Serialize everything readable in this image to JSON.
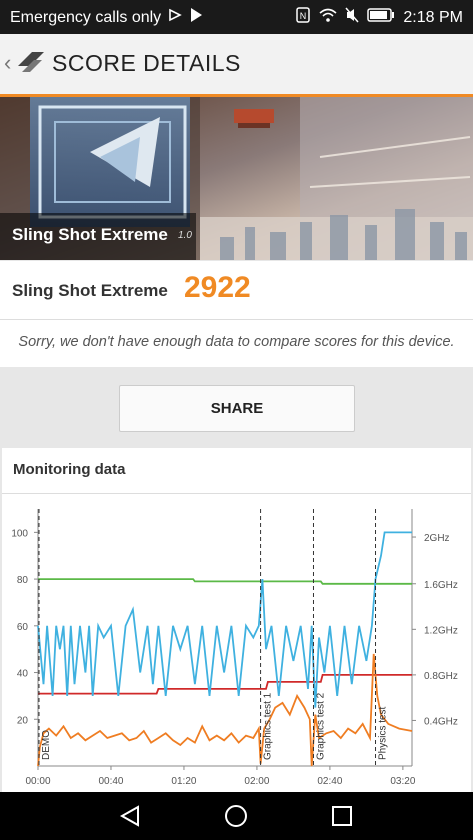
{
  "status": {
    "left_text": "Emergency calls only",
    "time": "2:18 PM"
  },
  "appbar": {
    "title": "SCORE DETAILS"
  },
  "banner": {
    "test_name": "Sling Shot Extreme",
    "version": "1.0"
  },
  "score": {
    "label": "Sling Shot Extreme",
    "value": "2922"
  },
  "note": "Sorry, we don't have enough data to compare scores for this device.",
  "share_label": "SHARE",
  "monitoring": {
    "title": "Monitoring data"
  },
  "chart_data": {
    "type": "line",
    "y_left_ticks": [
      "100",
      "80",
      "60",
      "40",
      "20"
    ],
    "y_right_ticks": [
      "2GHz",
      "1.6GHz",
      "1.2GHz",
      "0.8GHz",
      "0.4GHz"
    ],
    "x_ticks": [
      "00:00",
      "00:40",
      "01:20",
      "02:00",
      "02:40",
      "03:20"
    ],
    "ylim": [
      0,
      110
    ],
    "xlim_seconds": [
      0,
      205
    ],
    "markers": [
      {
        "label": "DEMO",
        "t": 0
      },
      {
        "label": "Graphics test 1",
        "t": 122
      },
      {
        "label": "Graphics test 2",
        "t": 151
      },
      {
        "label": "Physics test",
        "t": 185
      }
    ],
    "series": [
      {
        "color": "#5bb947",
        "t": [
          0,
          85,
          86,
          155,
          156,
          205
        ],
        "values": [
          80,
          80,
          79,
          79,
          78,
          78
        ]
      },
      {
        "color": "#d02a2a",
        "t": [
          0,
          65,
          66,
          125,
          126,
          155,
          156,
          205
        ],
        "values": [
          31,
          31,
          33,
          33,
          36,
          36,
          39,
          39
        ]
      },
      {
        "color": "#3fb1e0",
        "t": [
          0,
          3,
          5,
          8,
          10,
          12,
          14,
          16,
          18,
          20,
          23,
          26,
          28,
          30,
          33,
          36,
          40,
          44,
          48,
          52,
          56,
          60,
          63,
          66,
          70,
          74,
          78,
          82,
          86,
          90,
          94,
          98,
          102,
          106,
          110,
          114,
          118,
          121,
          123,
          125,
          128,
          132,
          136,
          140,
          144,
          148,
          150,
          152,
          154,
          157,
          160,
          164,
          168,
          172,
          176,
          180,
          183,
          185,
          188,
          190,
          195,
          205
        ],
        "values": [
          60,
          35,
          60,
          30,
          60,
          50,
          60,
          30,
          60,
          35,
          60,
          40,
          60,
          30,
          60,
          55,
          60,
          30,
          60,
          67,
          40,
          60,
          35,
          60,
          30,
          60,
          50,
          60,
          35,
          60,
          30,
          60,
          40,
          60,
          30,
          60,
          55,
          60,
          80,
          50,
          60,
          30,
          60,
          45,
          60,
          33,
          60,
          25,
          55,
          40,
          60,
          30,
          60,
          35,
          60,
          45,
          60,
          80,
          90,
          100,
          100,
          100
        ]
      },
      {
        "color": "#ef7d22",
        "t": [
          0,
          1,
          3,
          6,
          10,
          14,
          18,
          22,
          26,
          30,
          34,
          38,
          42,
          46,
          50,
          54,
          58,
          62,
          66,
          70,
          74,
          78,
          82,
          86,
          90,
          94,
          98,
          102,
          106,
          110,
          114,
          118,
          121,
          122,
          124,
          127,
          130,
          134,
          138,
          142,
          146,
          149,
          150,
          152,
          154,
          158,
          162,
          166,
          170,
          174,
          178,
          182,
          184,
          186,
          188,
          192,
          198,
          205
        ],
        "values": [
          0,
          8,
          14,
          16,
          13,
          17,
          12,
          14,
          11,
          13,
          15,
          12,
          13,
          14,
          11,
          12,
          15,
          10,
          12,
          14,
          11,
          9,
          12,
          10,
          17,
          11,
          13,
          11,
          14,
          10,
          13,
          12,
          16,
          1,
          16,
          20,
          25,
          27,
          22,
          30,
          25,
          20,
          0,
          22,
          12,
          14,
          15,
          12,
          16,
          14,
          18,
          12,
          48,
          30,
          22,
          18,
          16,
          15
        ]
      }
    ]
  }
}
